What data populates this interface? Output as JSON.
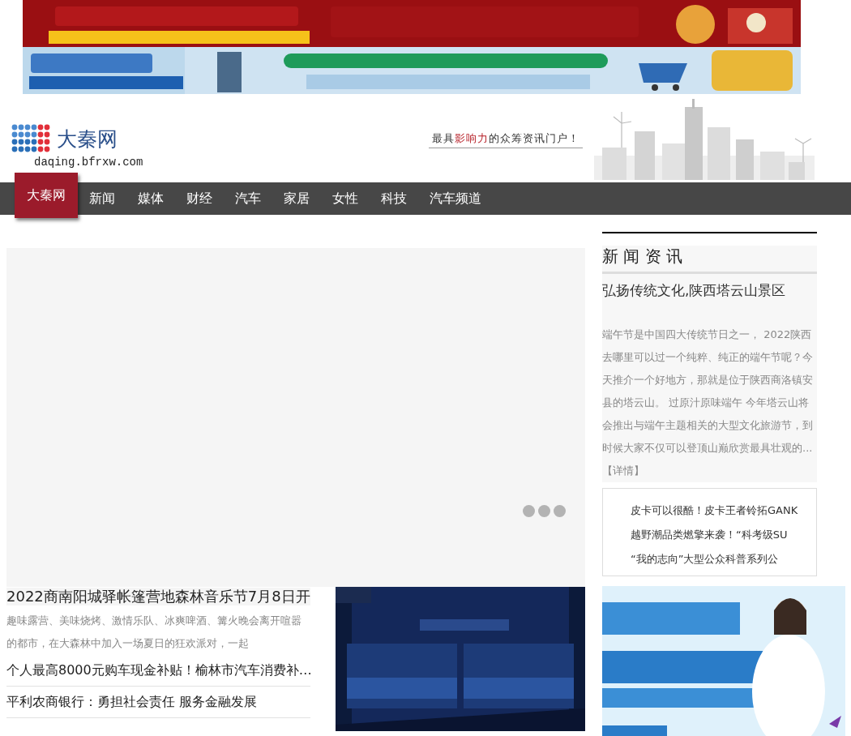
{
  "logo": {
    "name": "大秦网",
    "domain": "daqing.bfrxw.com"
  },
  "slogan": [
    "最具",
    "影响力",
    "的众筹资讯门户！"
  ],
  "nav": [
    {
      "label": "大秦网",
      "selected": true
    },
    {
      "label": "新闻",
      "selected": false
    },
    {
      "label": "媒体",
      "selected": false
    },
    {
      "label": "财经",
      "selected": false
    },
    {
      "label": "汽车",
      "selected": false
    },
    {
      "label": "家居",
      "selected": false
    },
    {
      "label": "女性",
      "selected": false
    },
    {
      "label": "科技",
      "selected": false
    },
    {
      "label": "汽车频道",
      "selected": false
    }
  ],
  "slider": {
    "dots": [
      {
        "selected": false
      },
      {
        "selected": false
      },
      {
        "selected": false
      }
    ]
  },
  "lead": {
    "title": "2022商南阳城驿帐篷营地森林音乐节7月8日开",
    "summary": "趣味露营、美味烧烤、激情乐队、冰爽啤酒、篝火晚会离开喧嚣的都市，在大森林中加入一场夏日的狂欢派对，一起"
  },
  "headlines": [
    "个人最高8000元购车现金补贴！榆林市汽车消费补…",
    "平利农商银行：勇担社会责任 服务金融发展"
  ],
  "news": {
    "section": "新 闻 资 讯",
    "title": "弘扬传统文化,陕西塔云山景区",
    "summary": "端午节是中国四大传统节日之一， 2022陕西去哪里可以过一个纯粹、纯正的端午节呢？今天推介一个好地方，那就是位于陕西商洛镇安县的塔云山。 过原汁原味端午 今年塔云山将会推出与端午主题相关的大型文化旅游节，到时候大家不仅可以登顶山巅欣赏最具壮观的...",
    "more": "【详情】",
    "ticker": [
      "皮卡可以很酷！皮卡王者铃拓GANK",
      "越野潮品类燃擎来袭！“科考级SU",
      "“我的志向”大型公众科普系列公"
    ]
  }
}
